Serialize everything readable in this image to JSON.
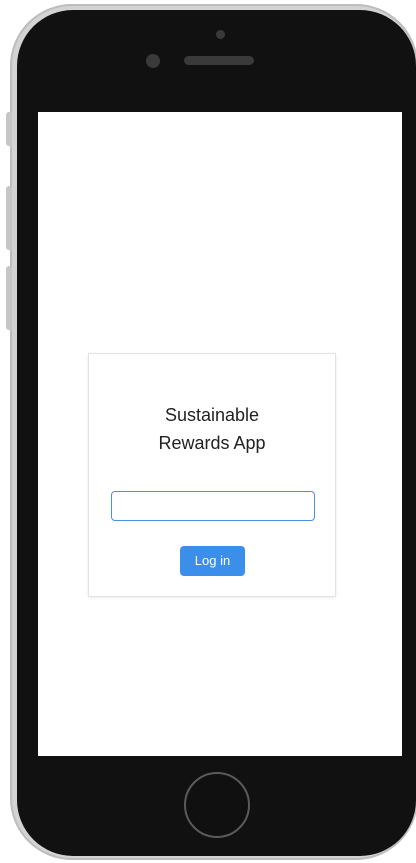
{
  "device": {
    "frame_color": "#111111",
    "bezel_color": "#d3d3d3",
    "screen_color": "#ffffff"
  },
  "login_card": {
    "title_line1": "Sustainable",
    "title_line2": "Rewards App",
    "input": {
      "value": "",
      "placeholder": ""
    },
    "login_button_label": "Log in",
    "accent_color": "#3b8eea"
  }
}
